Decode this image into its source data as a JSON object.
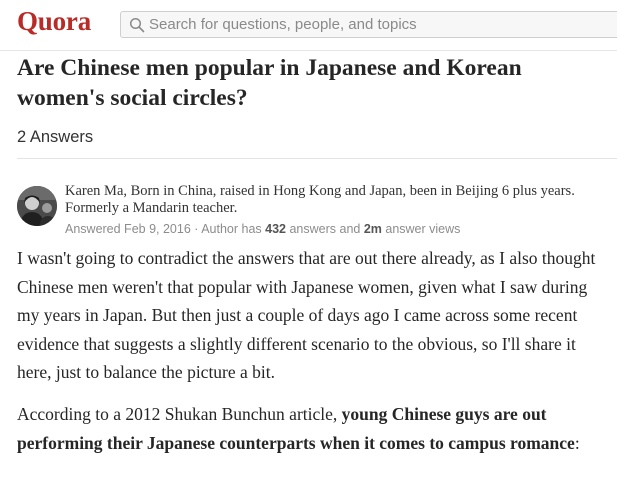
{
  "header": {
    "logo": "Quora",
    "search_placeholder": "Search for questions, people, and topics"
  },
  "question": {
    "title": "Are Chinese men popular in Japanese and Korean women's social circles?",
    "answer_count": "2 Answers"
  },
  "answer": {
    "author_credential": "Karen Ma, Born in China, raised in Hong Kong and Japan, been in Beijing 6 plus years. Formerly a Mandarin teacher.",
    "meta": {
      "answered": "Answered Feb 9, 2016",
      "sep": " · Author has ",
      "answers_count": "432",
      "answers_label": " answers and ",
      "views_count": "2m",
      "views_label": " answer views"
    },
    "paragraph_1": "I wasn't going to contradict the answers that are out there already, as I also thought Chinese men weren't that popular with Japanese women, given what I saw during my years in Japan.  But then just a couple of days ago I came across some recent evidence that suggests a slightly different scenario to the obvious, so I'll share it here, just to balance the picture a bit.",
    "paragraph_2_intro": "According to a 2012 Shukan Bunchun article,  ",
    "paragraph_2_bold": "young Chinese guys are out performing their Japanese counterparts when it comes to campus romance",
    "paragraph_2_end": ":"
  },
  "colors": {
    "brand": "#b92b27",
    "meta_text": "#8c8c8c"
  }
}
